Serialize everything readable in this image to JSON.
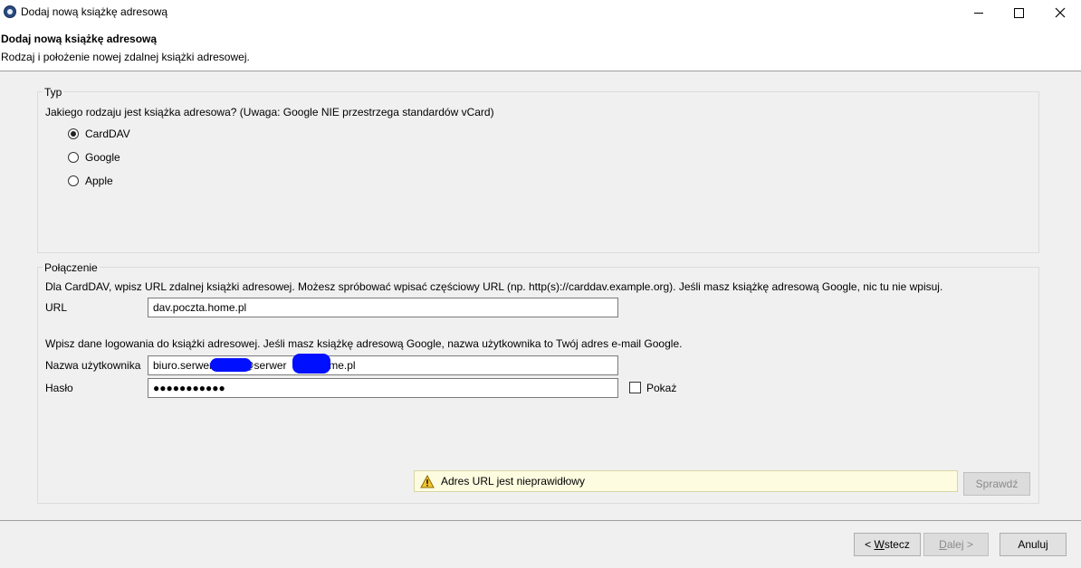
{
  "window": {
    "title": "Dodaj nową książkę adresową"
  },
  "header": {
    "title": "Dodaj nową książkę adresową",
    "subtitle": "Rodzaj i położenie nowej zdalnej książki adresowej."
  },
  "typ_group": {
    "legend": "Typ",
    "question": "Jakiego rodzaju jest książka adresowa? (Uwaga: Google NIE przestrzega standardów vCard)",
    "options": [
      {
        "label": "CardDAV",
        "checked": true
      },
      {
        "label": "Google",
        "checked": false
      },
      {
        "label": "Apple",
        "checked": false
      }
    ]
  },
  "connection_group": {
    "legend": "Połączenie",
    "info": "Dla CardDAV, wpisz URL zdalnej książki adresowej. Możesz spróbować wpisać częściowy URL (np. http(s)://carddav.example.org). Jeśli masz książkę adresową Google, nic tu nie wpisuj.",
    "url_label": "URL",
    "url_value": "dav.poczta.home.pl",
    "login_info": "Wpisz dane logowania do książki adresowej. Jeśli masz książkę adresową Google, nazwa użytkownika to Twój adres e-mail Google.",
    "username_label": "Nazwa użytkownika",
    "username_value": "biuro.serwer          @serwer          home.pl",
    "password_label": "Hasło",
    "password_value": "●●●●●●●●●●●",
    "show_label": "Pokaż",
    "warning": "Adres URL jest nieprawidłowy",
    "check_button": "Sprawdź"
  },
  "footer": {
    "back_prefix": "< ",
    "back_underline": "W",
    "back_rest": "stecz",
    "next_underline": "D",
    "next_rest": "alej >",
    "cancel": "Anuluj"
  },
  "colors": {
    "warning_bg": "#fefce0",
    "redaction": "#0010ff"
  }
}
